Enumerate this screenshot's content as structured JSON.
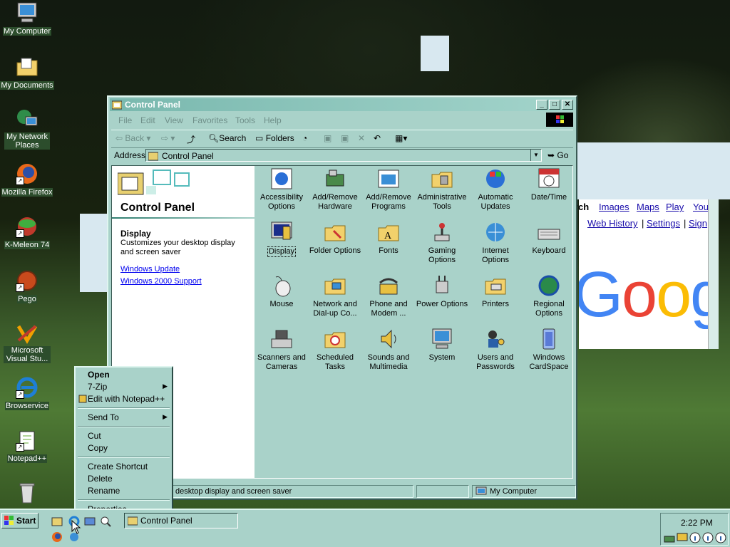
{
  "desktop": {
    "icons": [
      {
        "label": "My Computer",
        "icon": "computer-icon"
      },
      {
        "label": "My Documents",
        "icon": "folder-documents-icon"
      },
      {
        "label": "My Network Places",
        "icon": "network-icon"
      },
      {
        "label": "Mozilla Firefox",
        "icon": "firefox-icon"
      },
      {
        "label": "K-Meleon 74",
        "icon": "k-meleon-icon"
      },
      {
        "label": "Pego",
        "icon": "pego-icon"
      },
      {
        "label": "Microsoft Visual Stu...",
        "icon": "visual-studio-icon"
      },
      {
        "label": "Browservice",
        "icon": "internet-explorer-icon"
      },
      {
        "label": "Notepad++",
        "icon": "notepad-plus-plus-icon"
      }
    ]
  },
  "browser_behind": {
    "links_row1": [
      "rch",
      "Images",
      "Maps",
      "Play",
      "You"
    ],
    "links_row2": [
      "Web History",
      "|",
      "Settings",
      "|",
      "Sign"
    ],
    "logo_text": "Goog"
  },
  "window": {
    "title": "Control Panel",
    "menu": [
      "File",
      "Edit",
      "View",
      "Favorites",
      "Tools",
      "Help"
    ],
    "toolbar": {
      "back": "Back",
      "search": "Search",
      "folders": "Folders"
    },
    "address": {
      "label": "Address",
      "value": "Control Panel",
      "go": "Go"
    },
    "left_pane": {
      "title": "Control Panel",
      "selected_name": "Display",
      "selected_desc": "Customizes your desktop display and screen saver",
      "links": [
        "Windows Update",
        "Windows 2000 Support"
      ]
    },
    "items": [
      "Accessibility Options",
      "Add/Remove Hardware",
      "Add/Remove Programs",
      "Administrative Tools",
      "Automatic Updates",
      "Date/Time",
      "Display",
      "Folder Options",
      "Fonts",
      "Gaming Options",
      "Internet Options",
      "Keyboard",
      "Mouse",
      "Network and Dial-up Co...",
      "Phone and Modem ...",
      "Power Options",
      "Printers",
      "Regional Options",
      "Scanners and Cameras",
      "Scheduled Tasks",
      "Sounds and Multimedia",
      "System",
      "Users and Passwords",
      "Windows CardSpace"
    ],
    "status": {
      "left": "Customizes your desktop display and screen saver",
      "right": "My Computer"
    }
  },
  "context_menu": {
    "open": "Open",
    "zip": "7-Zip",
    "notepad": "Edit with Notepad++",
    "send_to": "Send To",
    "cut": "Cut",
    "copy": "Copy",
    "create_shortcut": "Create Shortcut",
    "delete": "Delete",
    "rename": "Rename",
    "properties": "Properties"
  },
  "taskbar": {
    "start": "Start",
    "task": "Control Panel",
    "clock": "2:22 PM"
  },
  "colors": {
    "theme": "#a9d2c9",
    "link": "#0000ee"
  }
}
